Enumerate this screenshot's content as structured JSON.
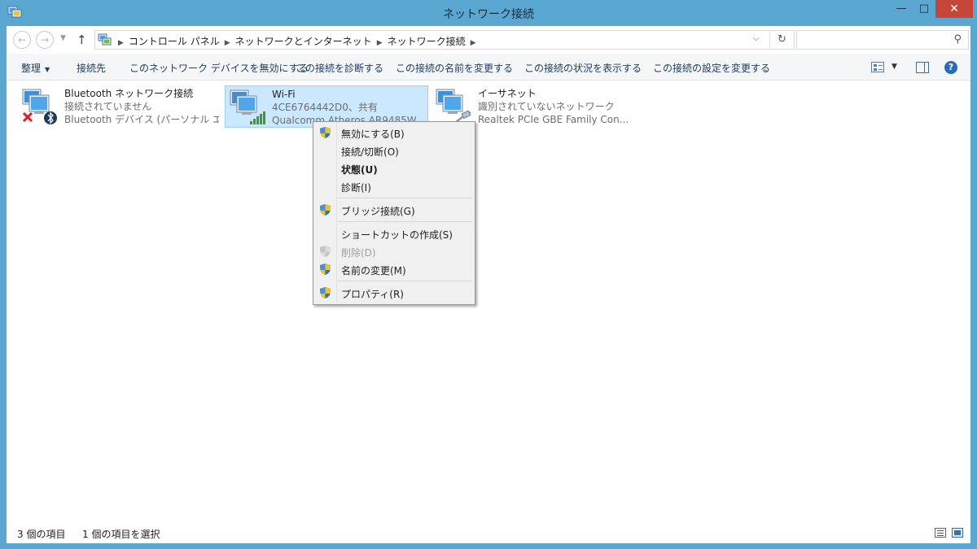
{
  "window": {
    "title": "ネットワーク接続",
    "minimize_glyph": "—",
    "maximize_glyph": "□",
    "close_glyph": "✕"
  },
  "nav": {
    "back_glyph": "←",
    "forward_glyph": "→",
    "dropdown_glyph": "▼",
    "up_glyph": "↑",
    "breadcrumbs": [
      "コントロール パネル",
      "ネットワークとインターネット",
      "ネットワーク接続"
    ],
    "address_dropdown_glyph": "⌵",
    "refresh_glyph": "↻",
    "search_value": "",
    "search_placeholder": ""
  },
  "toolbar": {
    "items": [
      "整理",
      "接続先",
      "このネットワーク デバイスを無効にする",
      "この接続を診断する",
      "この接続の名前を変更する",
      "この接続の状況を表示する",
      "この接続の設定を変更する"
    ],
    "organize_arrow": "▼",
    "view_dropdown_glyph": "▼",
    "help_glyph": "?"
  },
  "connections": [
    {
      "name": "Bluetooth ネットワーク接続",
      "status": "接続されていません",
      "device": "Bluetooth デバイス (パーソナル エ...",
      "icon": "network-computers-disconnected-bluetooth-icon"
    },
    {
      "name": "Wi-Fi",
      "status": "4CE6764442D0、共有",
      "device": "Qualcomm Atheros AR9485W...",
      "icon": "network-computers-wifi-signal-icon",
      "selected": true
    },
    {
      "name": "イーサネット",
      "status": "識別されていないネットワーク",
      "device": "Realtek PCIe GBE Family Con...",
      "icon": "network-computers-ethernet-cable-icon"
    }
  ],
  "context_menu": {
    "items": [
      {
        "label": "無効にする(B)",
        "icon": "uac-shield-icon"
      },
      {
        "label": "接続/切断(O)"
      },
      {
        "label": "状態(U)",
        "bold": true
      },
      {
        "label": "診断(I)"
      },
      {
        "label": "ブリッジ接続(G)",
        "icon": "uac-shield-icon"
      },
      {
        "label": "ショートカットの作成(S)"
      },
      {
        "label": "削除(D)",
        "icon": "uac-shield-disabled-icon",
        "disabled": true
      },
      {
        "label": "名前の変更(M)",
        "icon": "uac-shield-icon"
      },
      {
        "label": "プロパティ(R)",
        "icon": "uac-shield-icon"
      }
    ]
  },
  "status": {
    "item_count": "3 個の項目",
    "selected_count": "1 個の項目を選択"
  },
  "colors": {
    "frame": "#5aa7d2",
    "close_button": "#c7463a",
    "selection_fill": "#cce8ff",
    "selection_border": "#99d1ff",
    "menu_background": "#f0f0f0"
  }
}
